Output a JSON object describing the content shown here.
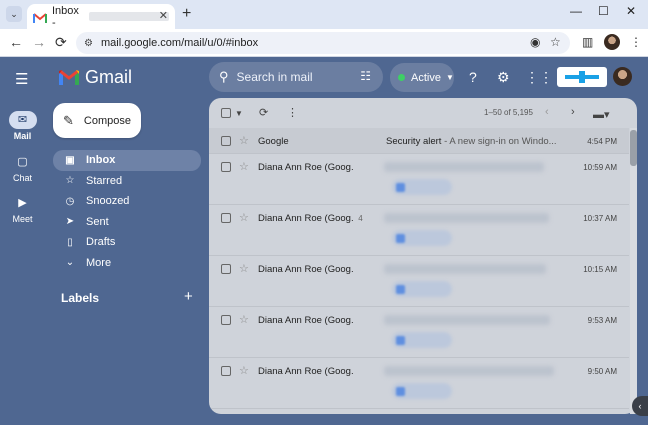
{
  "browser": {
    "tab_title": "Inbox -",
    "tab_close": "✕",
    "new_tab": "+",
    "minimize": "—",
    "maximize": "☐",
    "close": "✕",
    "back": "←",
    "forward": "→",
    "reload": "⟳",
    "url": "mail.google.com/mail/u/0/#inbox"
  },
  "gmail": {
    "app_name": "Gmail",
    "search_placeholder": "Search in mail",
    "status_label": "Active",
    "compose_label": "Compose",
    "labels_heading": "Labels",
    "labels_add": "+",
    "paging": "1–50 of 5,195"
  },
  "rail": [
    {
      "label": "Mail",
      "icon": "✉"
    },
    {
      "label": "Chat",
      "icon": "▢"
    },
    {
      "label": "Meet",
      "icon": "▶"
    }
  ],
  "nav": [
    {
      "label": "Inbox",
      "icon": "inbox-icon",
      "glyph": "▣"
    },
    {
      "label": "Starred",
      "icon": "star-icon",
      "glyph": "☆"
    },
    {
      "label": "Snoozed",
      "icon": "clock-icon",
      "glyph": "◷"
    },
    {
      "label": "Sent",
      "icon": "send-icon",
      "glyph": "➤"
    },
    {
      "label": "Drafts",
      "icon": "draft-icon",
      "glyph": "▯"
    },
    {
      "label": "More",
      "icon": "chevron-down-icon",
      "glyph": "⌄"
    }
  ],
  "emails": [
    {
      "sender": "Google",
      "count": "",
      "subject": "Security alert",
      "snippet": " - A new sign-in on Windo...",
      "time": "4:54 PM"
    },
    {
      "sender": "Diana Ann Roe (Goog.",
      "count": "",
      "time": "10:59 AM"
    },
    {
      "sender": "Diana Ann Roe (Goog.",
      "count": "4",
      "time": "10:37 AM"
    },
    {
      "sender": "Diana Ann Roe (Goog.",
      "count": "",
      "time": "10:15 AM"
    },
    {
      "sender": "Diana Ann Roe (Goog.",
      "count": "",
      "time": "9:53 AM"
    },
    {
      "sender": "Diana Ann Roe (Goog.",
      "count": "",
      "time": "9:50 AM"
    }
  ]
}
